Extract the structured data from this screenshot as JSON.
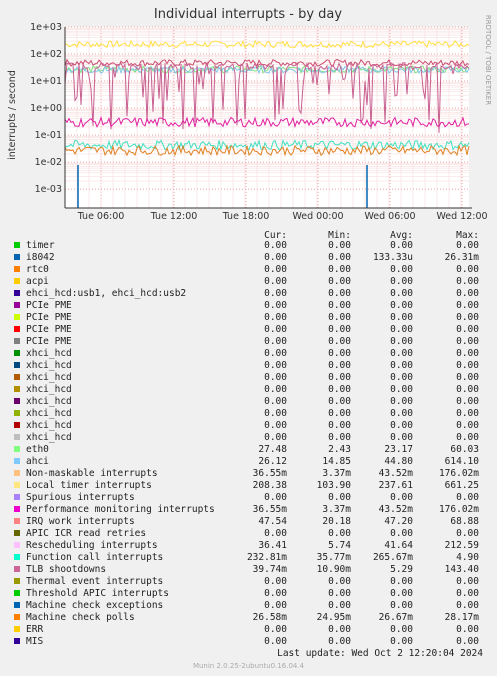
{
  "chart_data": {
    "type": "line",
    "title": "Individual interrupts - by day",
    "ylabel": "interrupts / second",
    "side_label": "RRDTOOL / TOBI OETIKER",
    "yscale": "log",
    "ylim": [
      0.0002,
      1000
    ],
    "y_ticks": [
      "1e-03",
      "1e-02",
      "1e-01",
      "1e+00",
      "1e+01",
      "1e+02",
      "1e+03"
    ],
    "x_ticks": [
      "Tue 06:00",
      "Tue 12:00",
      "Tue 18:00",
      "Wed 00:00",
      "Wed 06:00",
      "Wed 12:00"
    ],
    "grid": true,
    "series": [
      {
        "name": "Local timer interrupts",
        "color": "#ffe040",
        "level": 230
      },
      {
        "name": "IRQ work interrupts",
        "color": "#cc4c70",
        "level": 47
      },
      {
        "name": "eth0",
        "color": "#80e080",
        "level": 27
      },
      {
        "name": "ahci",
        "color": "#80c8e8",
        "level": 26
      },
      {
        "name": "Rescheduling interrupts",
        "color": "#c86090",
        "level": 36
      },
      {
        "name": "Non-maskable interrupts",
        "color": "#40e0c0",
        "level": 0.043
      },
      {
        "name": "Function call interrupts",
        "color": "#e020a0",
        "level": 0.3
      },
      {
        "name": "Machine check polls",
        "color": "#e08020",
        "level": 0.027
      }
    ]
  },
  "legend": {
    "headers": {
      "cur": "Cur:",
      "min": "Min:",
      "avg": "Avg:",
      "max": "Max:"
    },
    "rows": [
      {
        "name": "timer",
        "color": "#00cc00",
        "cur": "0.00",
        "min": "0.00",
        "avg": "0.00",
        "max": "0.00"
      },
      {
        "name": "i8042",
        "color": "#0066b3",
        "cur": "0.00",
        "min": "0.00",
        "avg": "133.33u",
        "max": "26.31m"
      },
      {
        "name": "rtc0",
        "color": "#ff8000",
        "cur": "0.00",
        "min": "0.00",
        "avg": "0.00",
        "max": "0.00"
      },
      {
        "name": "acpi",
        "color": "#ffcc00",
        "cur": "0.00",
        "min": "0.00",
        "avg": "0.00",
        "max": "0.00"
      },
      {
        "name": "ehci_hcd:usb1, ehci_hcd:usb2",
        "color": "#330099",
        "cur": "0.00",
        "min": "0.00",
        "avg": "0.00",
        "max": "0.00"
      },
      {
        "name": "PCIe PME",
        "color": "#990099",
        "cur": "0.00",
        "min": "0.00",
        "avg": "0.00",
        "max": "0.00"
      },
      {
        "name": "PCIe PME",
        "color": "#ccff00",
        "cur": "0.00",
        "min": "0.00",
        "avg": "0.00",
        "max": "0.00"
      },
      {
        "name": "PCIe PME",
        "color": "#ff0000",
        "cur": "0.00",
        "min": "0.00",
        "avg": "0.00",
        "max": "0.00"
      },
      {
        "name": "PCIe PME",
        "color": "#808080",
        "cur": "0.00",
        "min": "0.00",
        "avg": "0.00",
        "max": "0.00"
      },
      {
        "name": "xhci_hcd",
        "color": "#008f00",
        "cur": "0.00",
        "min": "0.00",
        "avg": "0.00",
        "max": "0.00"
      },
      {
        "name": "xhci_hcd",
        "color": "#00487d",
        "cur": "0.00",
        "min": "0.00",
        "avg": "0.00",
        "max": "0.00"
      },
      {
        "name": "xhci_hcd",
        "color": "#b35a00",
        "cur": "0.00",
        "min": "0.00",
        "avg": "0.00",
        "max": "0.00"
      },
      {
        "name": "xhci_hcd",
        "color": "#b38f00",
        "cur": "0.00",
        "min": "0.00",
        "avg": "0.00",
        "max": "0.00"
      },
      {
        "name": "xhci_hcd",
        "color": "#6b006b",
        "cur": "0.00",
        "min": "0.00",
        "avg": "0.00",
        "max": "0.00"
      },
      {
        "name": "xhci_hcd",
        "color": "#8fb300",
        "cur": "0.00",
        "min": "0.00",
        "avg": "0.00",
        "max": "0.00"
      },
      {
        "name": "xhci_hcd",
        "color": "#b30000",
        "cur": "0.00",
        "min": "0.00",
        "avg": "0.00",
        "max": "0.00"
      },
      {
        "name": "xhci_hcd",
        "color": "#bebebe",
        "cur": "0.00",
        "min": "0.00",
        "avg": "0.00",
        "max": "0.00"
      },
      {
        "name": "eth0",
        "color": "#80ff80",
        "cur": "27.48",
        "min": "2.43",
        "avg": "23.17",
        "max": "60.03"
      },
      {
        "name": "ahci",
        "color": "#80c9ff",
        "cur": "26.12",
        "min": "14.85",
        "avg": "44.80",
        "max": "614.10"
      },
      {
        "name": "Non-maskable interrupts",
        "color": "#ffc080",
        "cur": "36.55m",
        "min": "3.37m",
        "avg": "43.52m",
        "max": "176.02m"
      },
      {
        "name": "Local timer interrupts",
        "color": "#ffe680",
        "cur": "208.38",
        "min": "103.90",
        "avg": "237.61",
        "max": "661.25"
      },
      {
        "name": "Spurious interrupts",
        "color": "#aa80ff",
        "cur": "0.00",
        "min": "0.00",
        "avg": "0.00",
        "max": "0.00"
      },
      {
        "name": "Performance monitoring interrupts",
        "color": "#ee00cc",
        "cur": "36.55m",
        "min": "3.37m",
        "avg": "43.52m",
        "max": "176.02m"
      },
      {
        "name": "IRQ work interrupts",
        "color": "#ff8080",
        "cur": "47.54",
        "min": "20.18",
        "avg": "47.20",
        "max": "68.88"
      },
      {
        "name": "APIC ICR read retries",
        "color": "#666600",
        "cur": "0.00",
        "min": "0.00",
        "avg": "0.00",
        "max": "0.00"
      },
      {
        "name": "Rescheduling interrupts",
        "color": "#ffbfff",
        "cur": "36.41",
        "min": "5.74",
        "avg": "41.64",
        "max": "212.59"
      },
      {
        "name": "Function call interrupts",
        "color": "#00ffcc",
        "cur": "232.81m",
        "min": "35.77m",
        "avg": "265.67m",
        "max": "4.90"
      },
      {
        "name": "TLB shootdowns",
        "color": "#cc6699",
        "cur": "39.74m",
        "min": "10.90m",
        "avg": "5.29",
        "max": "143.40"
      },
      {
        "name": "Thermal event interrupts",
        "color": "#999900",
        "cur": "0.00",
        "min": "0.00",
        "avg": "0.00",
        "max": "0.00"
      },
      {
        "name": "Threshold APIC interrupts",
        "color": "#00cc00",
        "cur": "0.00",
        "min": "0.00",
        "avg": "0.00",
        "max": "0.00"
      },
      {
        "name": "Machine check exceptions",
        "color": "#0066b3",
        "cur": "0.00",
        "min": "0.00",
        "avg": "0.00",
        "max": "0.00"
      },
      {
        "name": "Machine check polls",
        "color": "#ff8000",
        "cur": "26.58m",
        "min": "24.95m",
        "avg": "26.67m",
        "max": "28.17m"
      },
      {
        "name": "ERR",
        "color": "#ffcc00",
        "cur": "0.00",
        "min": "0.00",
        "avg": "0.00",
        "max": "0.00"
      },
      {
        "name": "MIS",
        "color": "#330099",
        "cur": "0.00",
        "min": "0.00",
        "avg": "0.00",
        "max": "0.00"
      }
    ]
  },
  "footer": {
    "last_update": "Last update:  Wed Oct  2 12:20:04 2024",
    "munin": "Munin 2.0.25-2ubuntu0.16.04.4"
  }
}
